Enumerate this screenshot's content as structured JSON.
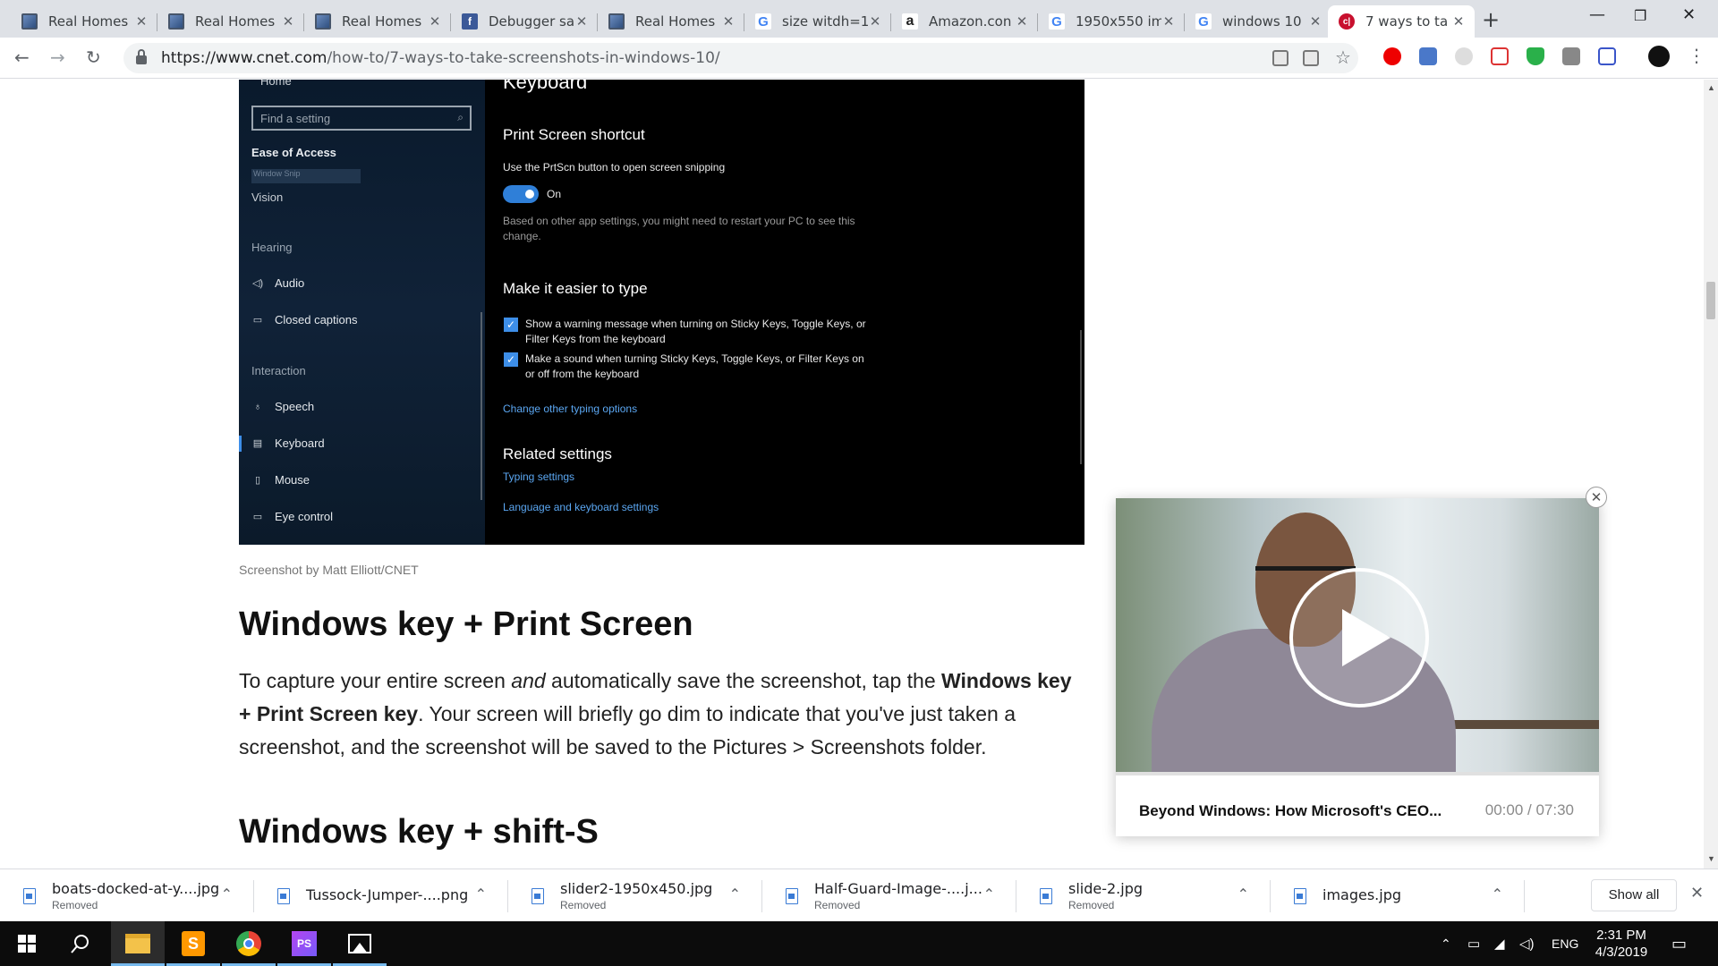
{
  "browser": {
    "tabs": [
      {
        "title": "Real Homes",
        "favicon": "real-homes-icon",
        "active": false
      },
      {
        "title": "Real Homes",
        "favicon": "real-homes-icon",
        "active": false
      },
      {
        "title": "Real Homes",
        "favicon": "real-homes-icon",
        "active": false
      },
      {
        "title": "Debugger sa",
        "favicon": "facebook-icon",
        "active": false
      },
      {
        "title": "Real Homes",
        "favicon": "real-homes-icon",
        "active": false
      },
      {
        "title": "size witdh=1",
        "favicon": "google-icon",
        "active": false
      },
      {
        "title": "Amazon.con",
        "favicon": "amazon-icon",
        "active": false
      },
      {
        "title": "1950x550 im",
        "favicon": "google-icon",
        "active": false
      },
      {
        "title": "windows 10",
        "favicon": "google-icon",
        "active": false
      },
      {
        "title": "7 ways to ta",
        "favicon": "cnet-icon",
        "active": true
      }
    ],
    "url_host": "https://www.cnet.com",
    "url_path": "/how-to/7-ways-to-take-screenshots-in-windows-10/"
  },
  "settings_shot": {
    "sidebar": {
      "home": "Home",
      "search_placeholder": "Find a setting",
      "section": "Ease of Access",
      "highlight": "Window Snip",
      "vision": "Vision",
      "hearing": "Hearing",
      "audio": "Audio",
      "closed_captions": "Closed captions",
      "interaction": "Interaction",
      "speech": "Speech",
      "keyboard": "Keyboard",
      "mouse": "Mouse",
      "eye_control": "Eye control"
    },
    "main": {
      "title": "Keyboard",
      "print_screen_heading": "Print Screen shortcut",
      "print_screen_desc": "Use the PrtScn button to open screen snipping",
      "toggle_label": "On",
      "restart_note": "Based on other app settings, you might need to restart your PC to see this change.",
      "type_heading": "Make it easier to type",
      "check1": "Show a warning message when turning on Sticky Keys, Toggle Keys, or Filter Keys from the keyboard",
      "check2": "Make a sound when turning Sticky Keys, Toggle Keys, or Filter Keys on or off from the keyboard",
      "typing_link": "Change other typing options",
      "related_heading": "Related settings",
      "related_link1": "Typing settings",
      "related_link2": "Language and keyboard settings"
    }
  },
  "article": {
    "caption": "Screenshot by Matt Elliott/CNET",
    "heading1": "Windows key + Print Screen",
    "para_1": "To capture your entire screen ",
    "para_em": "and",
    "para_2": " automatically save the screenshot, tap the ",
    "para_bold": "Windows key + Print Screen key",
    "para_3": ". Your screen will briefly go dim to indicate that you've just taken a screenshot, and the screenshot will be saved to the Pictures > Screenshots folder.",
    "heading2": "Windows key + shift-S"
  },
  "video": {
    "title": "Beyond Windows: How Microsoft's CEO...",
    "time": "00:00 / 07:30"
  },
  "downloads": {
    "items": [
      {
        "name": "boats-docked-at-y....jpg",
        "status": "Removed"
      },
      {
        "name": "Tussock-Jumper-....png",
        "status": ""
      },
      {
        "name": "slider2-1950x450.jpg",
        "status": "Removed"
      },
      {
        "name": "Half-Guard-Image-....j...",
        "status": "Removed"
      },
      {
        "name": "slide-2.jpg",
        "status": "Removed"
      },
      {
        "name": "images.jpg",
        "status": ""
      }
    ],
    "show_all": "Show all"
  },
  "taskbar": {
    "apps": [
      "file-explorer-icon",
      "sublime-text-icon",
      "chrome-icon",
      "phpstorm-icon",
      "photos-icon"
    ],
    "language": "ENG",
    "time": "2:31 PM",
    "date": "4/3/2019"
  },
  "colors": {
    "accent": "#3d8ee8",
    "taskbar_accent": "#76b9ed",
    "link": "#5ba7f2"
  }
}
